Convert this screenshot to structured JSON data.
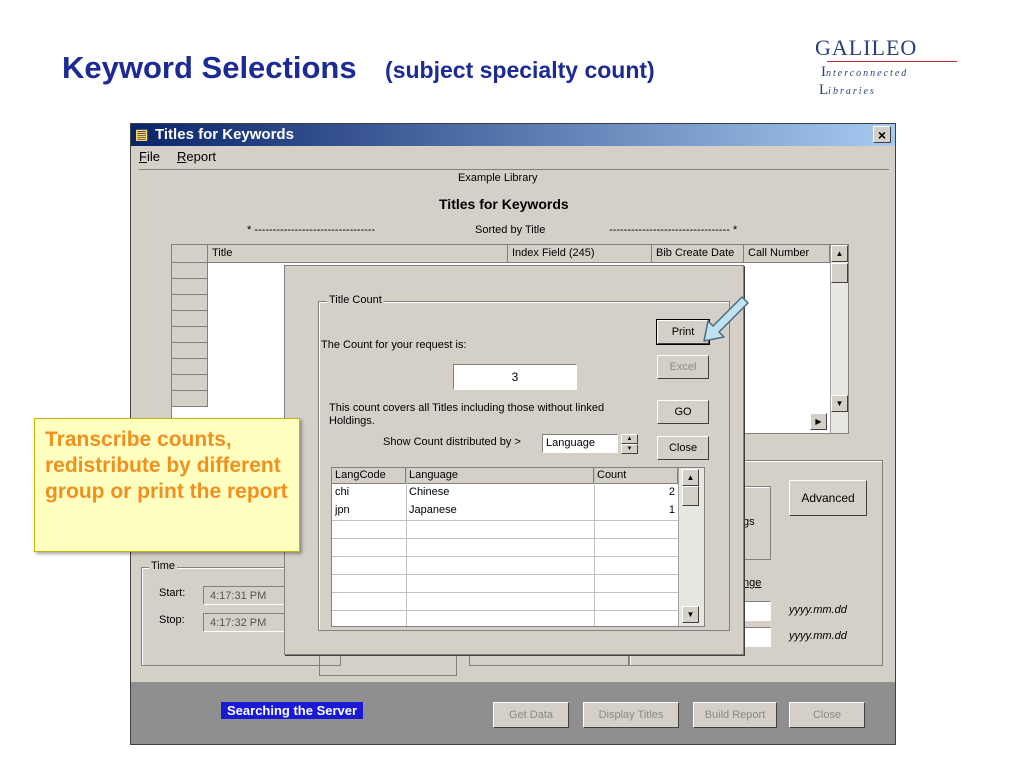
{
  "slide": {
    "title": "Keyword Selections",
    "subtitle": "(subject specialty count)"
  },
  "logo": {
    "line1": "GALILEO",
    "line2_initial": "I",
    "line2_rest": "nterconnected",
    "line3_initial": "L",
    "line3_rest": "ibraries"
  },
  "window": {
    "title": "Titles for Keywords",
    "close_label": "×",
    "menu": [
      "File",
      "Report"
    ]
  },
  "report": {
    "library": "Example Library",
    "heading": "Titles for Keywords",
    "sort_left": "* ---------------------------------",
    "sort_label": "Sorted by Title",
    "sort_right": "--------------------------------- *"
  },
  "grid": {
    "columns": [
      "Title",
      "Index Field (245)",
      "Bib Create Date",
      "Call Number"
    ]
  },
  "time": {
    "legend": "Time",
    "start_label": "Start:",
    "start_value": "4:17:31 PM",
    "stop_label": "Stop:",
    "stop_value": "4:17:32 PM"
  },
  "right_panel": {
    "advanced_label": "Advanced",
    "partial_text": "gs",
    "range_label": "nge",
    "date_format_1": "yyyy.mm.dd",
    "date_format_2": "yyyy.mm.dd"
  },
  "dialog": {
    "group_title": "Title Count",
    "count_prompt": "The Count for your request is:",
    "count_value": "3",
    "note": "This count covers all Titles including those without linked Holdings.",
    "distribute_label": "Show Count distributed by >",
    "distribute_value": "Language",
    "buttons": {
      "print": "Print",
      "excel": "Excel",
      "go": "GO",
      "close": "Close"
    },
    "table": {
      "headers": [
        "LangCode",
        "Language",
        "Count"
      ],
      "rows": [
        {
          "code": "chi",
          "language": "Chinese",
          "count": "2"
        },
        {
          "code": "jpn",
          "language": "Japanese",
          "count": "1"
        }
      ]
    }
  },
  "bottom": {
    "status": "Searching the Server",
    "buttons": [
      "Get Data",
      "Display Titles",
      "Build Report",
      "Close"
    ]
  },
  "callout": {
    "text": "Transcribe counts, redistribute by different group or print the report"
  },
  "colors": {
    "title_blue": "#1b2a94",
    "callout_text": "#f09020",
    "callout_bg": "#ffffc0",
    "arrow_fill": "#bfe3ee",
    "status_bg": "#1a1ad6"
  }
}
